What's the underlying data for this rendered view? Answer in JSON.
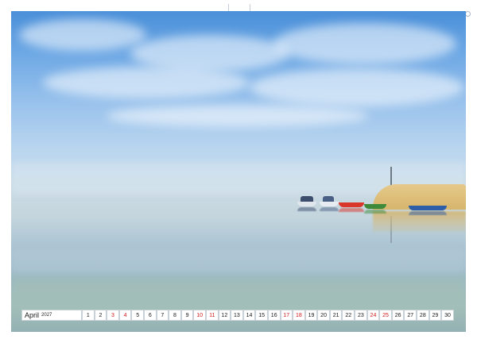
{
  "calendar": {
    "month": "April",
    "year": "2027",
    "days": [
      {
        "n": "1",
        "red": false
      },
      {
        "n": "2",
        "red": false
      },
      {
        "n": "3",
        "red": true
      },
      {
        "n": "4",
        "red": true
      },
      {
        "n": "5",
        "red": false
      },
      {
        "n": "6",
        "red": false
      },
      {
        "n": "7",
        "red": false
      },
      {
        "n": "8",
        "red": false
      },
      {
        "n": "9",
        "red": false
      },
      {
        "n": "10",
        "red": true
      },
      {
        "n": "11",
        "red": true
      },
      {
        "n": "12",
        "red": false
      },
      {
        "n": "13",
        "red": false
      },
      {
        "n": "14",
        "red": false
      },
      {
        "n": "15",
        "red": false
      },
      {
        "n": "16",
        "red": false
      },
      {
        "n": "17",
        "red": true
      },
      {
        "n": "18",
        "red": true
      },
      {
        "n": "19",
        "red": false
      },
      {
        "n": "20",
        "red": false
      },
      {
        "n": "21",
        "red": false
      },
      {
        "n": "22",
        "red": false
      },
      {
        "n": "23",
        "red": false
      },
      {
        "n": "24",
        "red": true
      },
      {
        "n": "25",
        "red": true
      },
      {
        "n": "26",
        "red": false
      },
      {
        "n": "27",
        "red": false
      },
      {
        "n": "28",
        "red": false
      },
      {
        "n": "29",
        "red": false
      },
      {
        "n": "30",
        "red": false
      }
    ]
  },
  "colors": {
    "sky_top": "#4a8fd9",
    "water": "#9ab9c4",
    "reeds": "#d6b56c",
    "weekend_text": "#d21b1b"
  },
  "photo": {
    "icon": "lake-landscape-photo"
  }
}
